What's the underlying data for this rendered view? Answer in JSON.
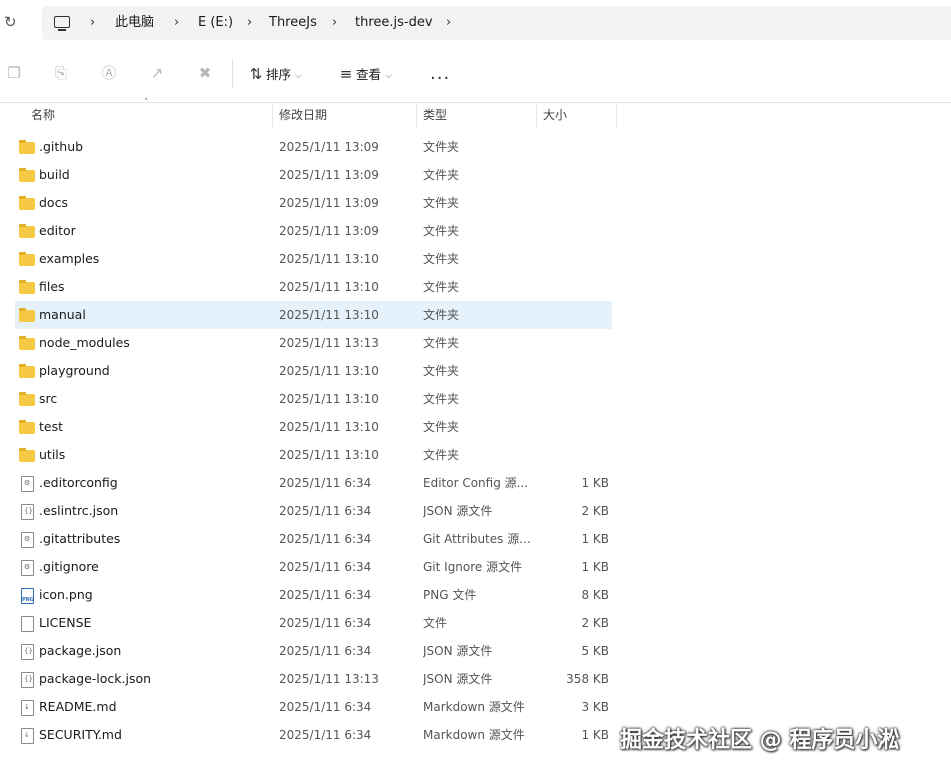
{
  "address": {
    "crumbs": [
      "此电脑",
      "E (E:)",
      "ThreeJs",
      "three.js-dev"
    ]
  },
  "toolbar": {
    "sort_label": "排序",
    "view_label": "查看",
    "more_label": "..."
  },
  "columns": {
    "name": "名称",
    "date": "修改日期",
    "type": "类型",
    "size": "大小"
  },
  "files": [
    {
      "name": ".github",
      "date": "2025/1/11 13:09",
      "type": "文件夹",
      "size": "",
      "kind": "folder"
    },
    {
      "name": "build",
      "date": "2025/1/11 13:09",
      "type": "文件夹",
      "size": "",
      "kind": "folder"
    },
    {
      "name": "docs",
      "date": "2025/1/11 13:09",
      "type": "文件夹",
      "size": "",
      "kind": "folder"
    },
    {
      "name": "editor",
      "date": "2025/1/11 13:09",
      "type": "文件夹",
      "size": "",
      "kind": "folder"
    },
    {
      "name": "examples",
      "date": "2025/1/11 13:10",
      "type": "文件夹",
      "size": "",
      "kind": "folder"
    },
    {
      "name": "files",
      "date": "2025/1/11 13:10",
      "type": "文件夹",
      "size": "",
      "kind": "folder"
    },
    {
      "name": "manual",
      "date": "2025/1/11 13:10",
      "type": "文件夹",
      "size": "",
      "kind": "folder",
      "selected": true
    },
    {
      "name": "node_modules",
      "date": "2025/1/11 13:13",
      "type": "文件夹",
      "size": "",
      "kind": "folder"
    },
    {
      "name": "playground",
      "date": "2025/1/11 13:10",
      "type": "文件夹",
      "size": "",
      "kind": "folder"
    },
    {
      "name": "src",
      "date": "2025/1/11 13:10",
      "type": "文件夹",
      "size": "",
      "kind": "folder"
    },
    {
      "name": "test",
      "date": "2025/1/11 13:10",
      "type": "文件夹",
      "size": "",
      "kind": "folder"
    },
    {
      "name": "utils",
      "date": "2025/1/11 13:10",
      "type": "文件夹",
      "size": "",
      "kind": "folder"
    },
    {
      "name": ".editorconfig",
      "date": "2025/1/11 6:34",
      "type": "Editor Config 源...",
      "size": "1 KB",
      "kind": "config"
    },
    {
      "name": ".eslintrc.json",
      "date": "2025/1/11 6:34",
      "type": "JSON 源文件",
      "size": "2 KB",
      "kind": "json"
    },
    {
      "name": ".gitattributes",
      "date": "2025/1/11 6:34",
      "type": "Git Attributes 源...",
      "size": "1 KB",
      "kind": "config"
    },
    {
      "name": ".gitignore",
      "date": "2025/1/11 6:34",
      "type": "Git Ignore 源文件",
      "size": "1 KB",
      "kind": "config"
    },
    {
      "name": "icon.png",
      "date": "2025/1/11 6:34",
      "type": "PNG 文件",
      "size": "8 KB",
      "kind": "png"
    },
    {
      "name": "LICENSE",
      "date": "2025/1/11 6:34",
      "type": "文件",
      "size": "2 KB",
      "kind": "plain"
    },
    {
      "name": "package.json",
      "date": "2025/1/11 6:34",
      "type": "JSON 源文件",
      "size": "5 KB",
      "kind": "json"
    },
    {
      "name": "package-lock.json",
      "date": "2025/1/11 13:13",
      "type": "JSON 源文件",
      "size": "358 KB",
      "kind": "json"
    },
    {
      "name": "README.md",
      "date": "2025/1/11 6:34",
      "type": "Markdown 源文件",
      "size": "3 KB",
      "kind": "md"
    },
    {
      "name": "SECURITY.md",
      "date": "2025/1/11 6:34",
      "type": "Markdown 源文件",
      "size": "1 KB",
      "kind": "md"
    }
  ],
  "watermark": "掘金技术社区 @ 程序员小淞",
  "colors": {
    "selection": "#e5f1fb",
    "folder": "#f6c944"
  }
}
